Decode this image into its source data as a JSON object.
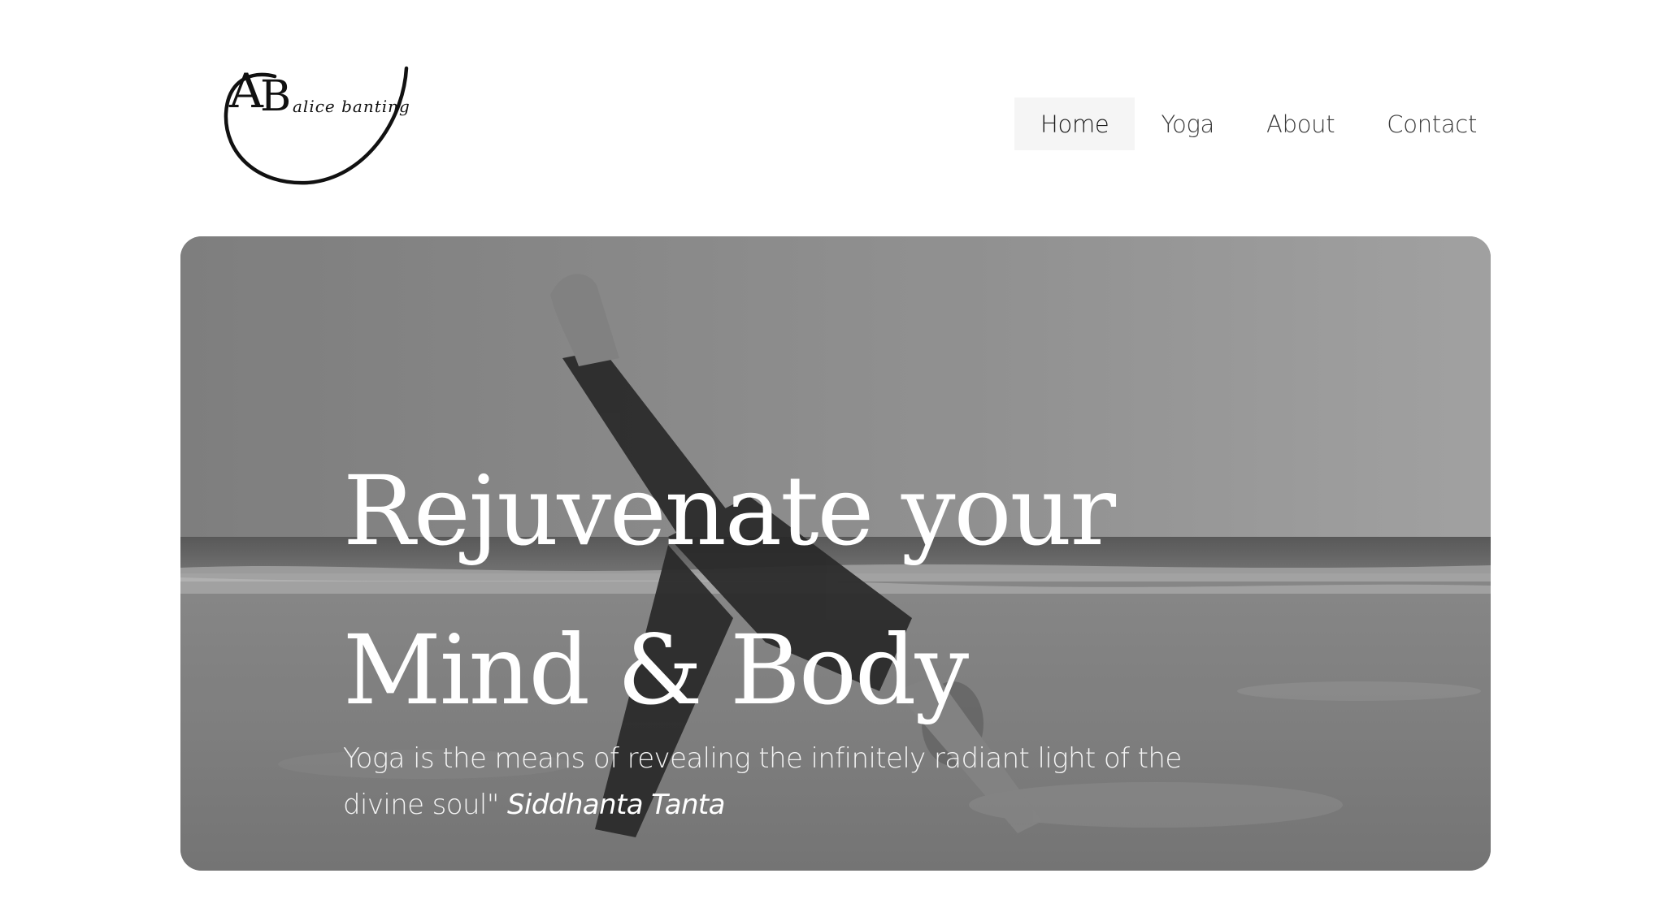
{
  "logo": {
    "monogram": "AB",
    "name": "alice banting"
  },
  "nav": {
    "items": [
      {
        "label": "Home",
        "active": true
      },
      {
        "label": "Yoga",
        "active": false
      },
      {
        "label": "About",
        "active": false
      },
      {
        "label": "Contact",
        "active": false
      }
    ]
  },
  "hero": {
    "title_line1": "Rejuvenate your",
    "title_line2": "Mind & Body",
    "quote_text": "Yoga is the means of revealing the infinitely radiant light of the divine soul\"",
    "quote_author": "Siddhanta Tanta",
    "image_description": "yoga-pose-on-beach-photo"
  },
  "colors": {
    "active_nav_bg": "#f5f5f5",
    "nav_text": "#3a3a3a",
    "hero_text": "#ffffff"
  }
}
